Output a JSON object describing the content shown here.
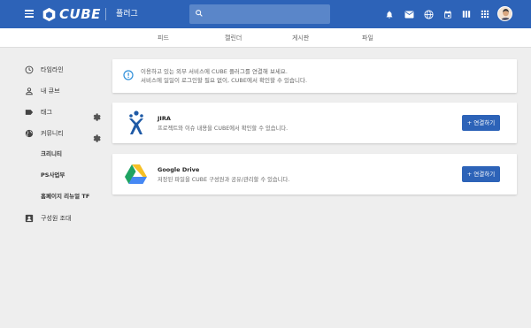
{
  "header": {
    "logo_text": "CUBE",
    "page_title": "플러그",
    "search_placeholder": ""
  },
  "subnav": {
    "tabs": [
      {
        "label": "피드"
      },
      {
        "label": "캘린더"
      },
      {
        "label": "게시판"
      },
      {
        "label": "파일"
      }
    ]
  },
  "sidebar": {
    "items": [
      {
        "label": "타임라인",
        "icon": "clock-icon"
      },
      {
        "label": "내 큐브",
        "icon": "person-icon"
      },
      {
        "label": "태그",
        "icon": "tag-icon"
      },
      {
        "label": "커뮤니티",
        "icon": "globe-icon"
      }
    ],
    "community_subitems": [
      {
        "label": "크리니티"
      },
      {
        "label": "PS사업부"
      },
      {
        "label": "홈페이지 리뉴얼 TF"
      }
    ],
    "members": {
      "label": "구성원 조대",
      "icon": "contact-card-icon"
    }
  },
  "notice": {
    "line1": "이용하고 있는 외부 서비스에 CUBE 플러그를 연결해 보세요.",
    "line2": "서비스에 일일이 로그인할 필요 없이, CUBE에서 확인할 수 있습니다."
  },
  "integrations": [
    {
      "name": "JIRA",
      "description": "프로젝트와 이슈 내용을 CUBE에서 확인할 수 있습니다.",
      "button": "+ 연결하기"
    },
    {
      "name": "Google Drive",
      "description": "저장된 파일을 CUBE 구성원과 공유/관리할 수 있습니다.",
      "button": "+ 연결하기"
    }
  ],
  "colors": {
    "brand": "#2d63b8",
    "background": "#eeeeee"
  }
}
